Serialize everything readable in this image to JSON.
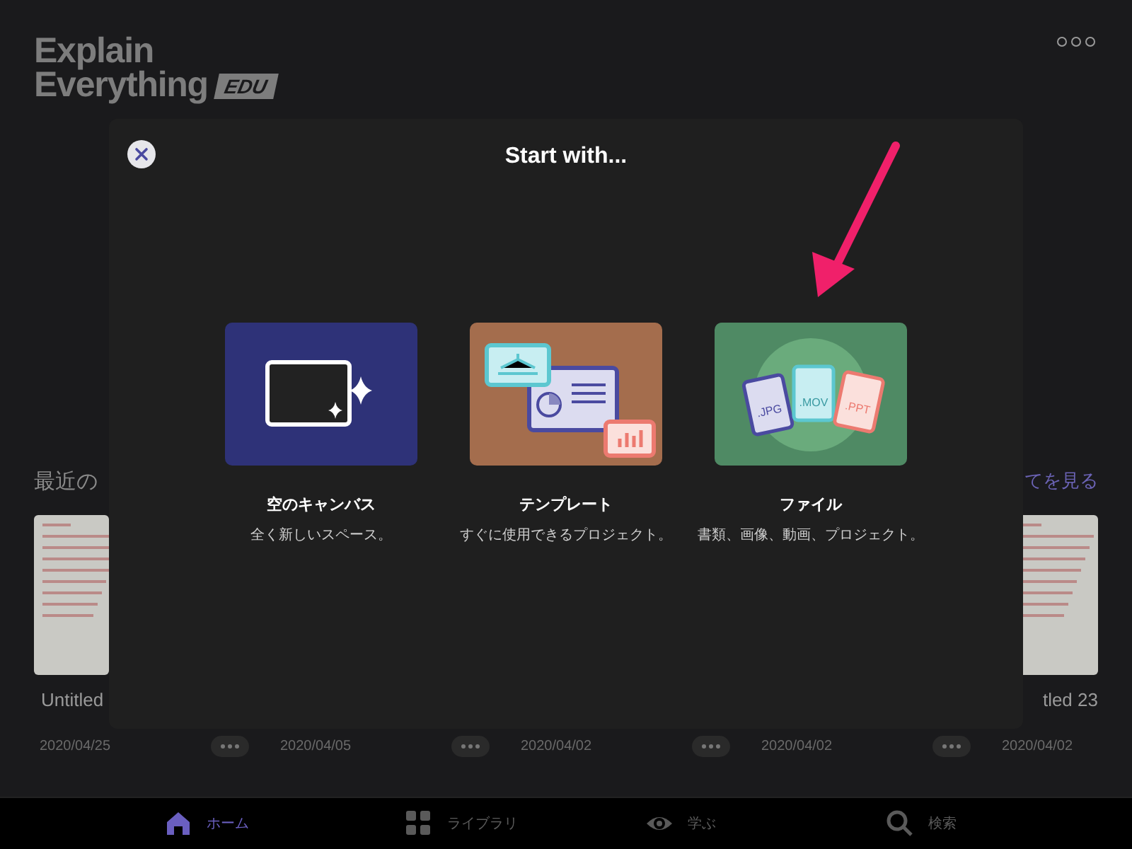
{
  "header": {
    "logo_line_1": "Explain",
    "logo_line_2": "Everything",
    "badge": "EDU"
  },
  "recent": {
    "heading": "最近の",
    "see_all": "てを見る",
    "files": [
      {
        "title": "Untitled",
        "date": "2020/04/25",
        "menu": true
      },
      {
        "date": "2020/04/05",
        "menu": true
      },
      {
        "date": "2020/04/02",
        "menu": true
      },
      {
        "date": "2020/04/02",
        "menu": true
      },
      {
        "title": "tled 23",
        "date": "2020/04/02"
      }
    ]
  },
  "dialog": {
    "title": "Start with...",
    "options": [
      {
        "kind": "blank",
        "title": "空のキャンバス",
        "subtitle": "全く新しいスペース。"
      },
      {
        "kind": "template",
        "title": "テンプレート",
        "subtitle": "すぐに使用できるプロジェクト。"
      },
      {
        "kind": "file",
        "title": "ファイル",
        "subtitle": "書類、画像、動画、プロジェクト。",
        "file_labels": [
          ".JPG",
          ".MOV",
          ".PPT"
        ]
      }
    ]
  },
  "nav": [
    {
      "kind": "home",
      "label": "ホーム",
      "selected": true
    },
    {
      "kind": "library",
      "label": "ライブラリ",
      "selected": false
    },
    {
      "kind": "learn",
      "label": "学ぶ",
      "selected": false
    },
    {
      "kind": "search",
      "label": "検索",
      "selected": false
    }
  ]
}
